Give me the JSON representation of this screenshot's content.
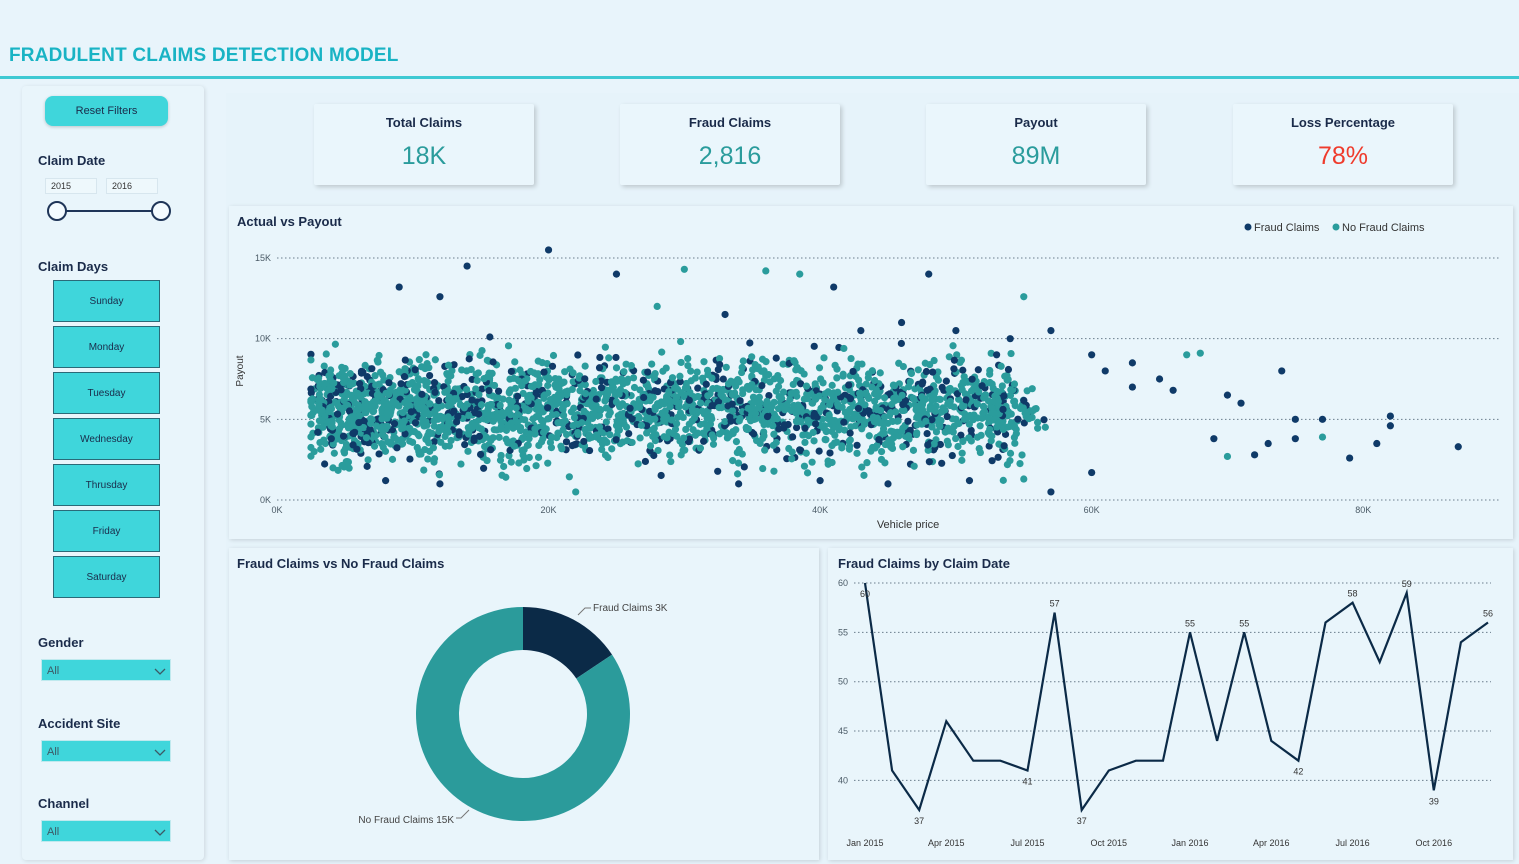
{
  "header": {
    "title": "FRADULENT CLAIMS DETECTION MODEL"
  },
  "sidebar": {
    "reset_label": "Reset Filters",
    "claim_date": {
      "label": "Claim Date",
      "from": "2015",
      "to": "2016"
    },
    "claim_days": {
      "label": "Claim Days",
      "days": [
        "Sunday",
        "Monday",
        "Tuesday",
        "Wednesday",
        "Thrusday",
        "Friday",
        "Saturday"
      ]
    },
    "gender": {
      "label": "Gender",
      "value": "All"
    },
    "accident_site": {
      "label": "Accident Site",
      "value": "All"
    },
    "channel": {
      "label": "Channel",
      "value": "All"
    }
  },
  "kpis": [
    {
      "label": "Total Claims",
      "value": "18K",
      "color": "#2a9c9c"
    },
    {
      "label": "Fraud Claims",
      "value": "2,816",
      "color": "#2a9c9c"
    },
    {
      "label": "Payout",
      "value": "89M",
      "color": "#2a9c9c"
    },
    {
      "label": "Loss Percentage",
      "value": "78%",
      "color": "#ef3b2c"
    }
  ],
  "colors": {
    "fraud": "#0f3a68",
    "no_fraud": "#2a9c9c",
    "accent": "#3fd6db",
    "donut_fraud": "#0b2a47",
    "donut_nofraud": "#2b9b9b",
    "line": "#0b2a47"
  },
  "chart_data": [
    {
      "type": "scatter",
      "title": "Actual vs Payout",
      "xlabel": "Vehicle price",
      "ylabel": "Payout",
      "xlim": [
        0,
        90000
      ],
      "ylim": [
        0,
        15000
      ],
      "x_ticks": [
        "0K",
        "20K",
        "40K",
        "60K",
        "80K"
      ],
      "y_ticks": [
        "0K",
        "5K",
        "10K",
        "15K"
      ],
      "legend": "top-right",
      "series": [
        {
          "name": "Fraud Claims",
          "color": "#0f3a68"
        },
        {
          "name": "No Fraud Claims",
          "color": "#2a9c9c"
        }
      ],
      "points": [
        [
          20000,
          15500,
          1
        ],
        [
          14000,
          14500,
          1
        ],
        [
          30000,
          14300,
          0
        ],
        [
          36000,
          14200,
          0
        ],
        [
          38500,
          14000,
          0
        ],
        [
          48000,
          14000,
          1
        ],
        [
          55000,
          12600,
          0
        ],
        [
          41000,
          13200,
          1
        ],
        [
          57000,
          10500,
          1
        ],
        [
          54000,
          10000,
          1
        ],
        [
          53000,
          9000,
          1
        ],
        [
          60000,
          9000,
          1
        ],
        [
          67000,
          9000,
          0
        ],
        [
          68000,
          9100,
          0
        ],
        [
          74000,
          8000,
          1
        ],
        [
          65000,
          7500,
          1
        ],
        [
          63000,
          7000,
          1
        ],
        [
          70000,
          6500,
          1
        ],
        [
          71000,
          6000,
          1
        ],
        [
          75000,
          5000,
          1
        ],
        [
          77000,
          5000,
          1
        ],
        [
          82000,
          5200,
          1
        ],
        [
          82000,
          4600,
          1
        ],
        [
          77000,
          3900,
          0
        ],
        [
          75000,
          3800,
          1
        ],
        [
          81000,
          3500,
          1
        ],
        [
          79000,
          2600,
          1
        ],
        [
          87000,
          3300,
          1
        ],
        [
          72000,
          2800,
          1
        ],
        [
          73000,
          3500,
          1
        ],
        [
          70000,
          2700,
          0
        ],
        [
          69000,
          3800,
          1
        ],
        [
          60000,
          1700,
          1
        ],
        [
          57000,
          500,
          1
        ],
        [
          51000,
          1200,
          1
        ],
        [
          55000,
          1300,
          0
        ],
        [
          45000,
          1000,
          1
        ],
        [
          40000,
          1200,
          1
        ],
        [
          34000,
          1000,
          1
        ],
        [
          22000,
          500,
          0
        ],
        [
          12000,
          1000,
          1
        ],
        [
          8000,
          1200,
          1
        ],
        [
          3000,
          4200,
          1
        ],
        [
          4000,
          3800,
          1
        ],
        [
          12000,
          12600,
          1
        ],
        [
          9000,
          13200,
          1
        ],
        [
          25000,
          14000,
          1
        ],
        [
          28000,
          12000,
          0
        ],
        [
          33000,
          11500,
          1
        ],
        [
          43000,
          10500,
          1
        ],
        [
          46000,
          11000,
          1
        ],
        [
          50000,
          10500,
          1
        ],
        [
          61000,
          8000,
          1
        ],
        [
          63000,
          8500,
          1
        ],
        [
          66000,
          6800,
          1
        ]
      ]
    },
    {
      "type": "pie",
      "title": "Fraud Claims vs No Fraud Claims",
      "categories": [
        "Fraud Claims",
        "No Fraud Claims"
      ],
      "values": [
        2816,
        15181
      ],
      "labels": [
        "Fraud Claims 3K",
        "No Fraud Claims 15K"
      ]
    },
    {
      "type": "line",
      "title": "Fraud Claims by Claim Date",
      "ylim": [
        37,
        60
      ],
      "y_ticks": [
        40,
        45,
        50,
        55,
        60
      ],
      "x_ticks": [
        "Jan 2015",
        "Apr 2015",
        "Jul 2015",
        "Oct 2015",
        "Jan 2016",
        "Apr 2016",
        "Jul 2016",
        "Oct 2016"
      ],
      "x": [
        "Jan 2015",
        "Feb 2015",
        "Mar 2015",
        "Apr 2015",
        "May 2015",
        "Jun 2015",
        "Jul 2015",
        "Aug 2015",
        "Sep 2015",
        "Oct 2015",
        "Nov 2015",
        "Dec 2015",
        "Jan 2016",
        "Feb 2016",
        "Mar 2016",
        "Apr 2016",
        "May 2016",
        "Jun 2016",
        "Jul 2016",
        "Aug 2016",
        "Sep 2016",
        "Oct 2016",
        "Nov 2016",
        "Dec 2016"
      ],
      "values": [
        60,
        41,
        37,
        46,
        42,
        42,
        41,
        57,
        37,
        41,
        42,
        42,
        55,
        44,
        55,
        44,
        42,
        56,
        58,
        52,
        59,
        39,
        54,
        56
      ],
      "data_labels": [
        60,
        null,
        37,
        null,
        null,
        null,
        41,
        57,
        37,
        null,
        null,
        null,
        55,
        null,
        55,
        null,
        42,
        null,
        58,
        null,
        59,
        39,
        null,
        56
      ]
    }
  ]
}
